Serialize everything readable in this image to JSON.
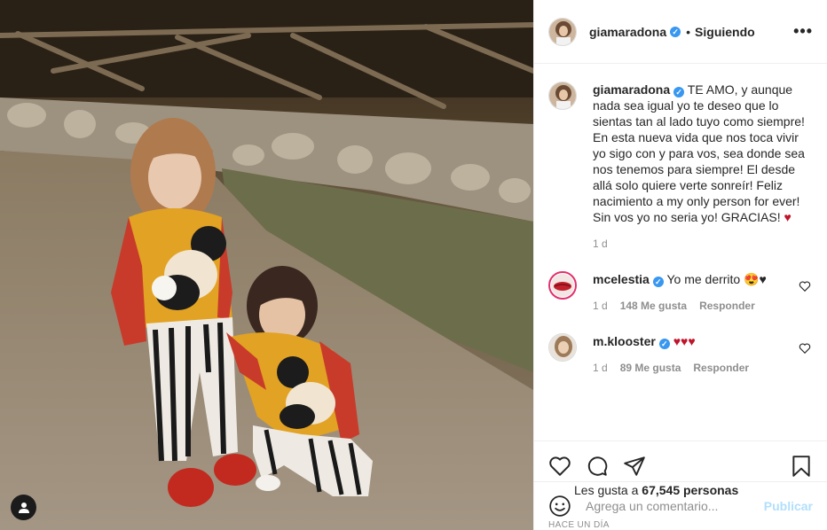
{
  "post": {
    "username": "giamaradona",
    "follow_state": "Siguiendo",
    "more_glyph": "•••",
    "caption_username": "giamaradona",
    "caption": "TE AMO, y aunque nada sea igual yo te deseo que lo sientas tan al lado tuyo como siempre! En esta nueva vida que nos toca vivir yo sigo con y para vos, sea donde sea nos tenemos para siempre! El desde allá solo quiere verte sonreír! Feliz nacimiento a my only person for ever! Sin vos yo no seria yo! GRACIAS! ",
    "caption_emoji": "♥",
    "caption_time": "1 d",
    "likes_prefix": "Les gusta a",
    "likes_count": "67,545",
    "likes_suffix": "personas",
    "age": "HACE UN DÍA"
  },
  "comments": [
    {
      "username": "mcelestia",
      "text": "Yo me derrito 😍♥",
      "time": "1 d",
      "likes": "148 Me gusta",
      "reply": "Responder"
    },
    {
      "username": "m.klooster",
      "text": "♥♥♥",
      "time": "1 d",
      "likes": "89 Me gusta",
      "reply": "Responder"
    }
  ],
  "composer": {
    "placeholder": "Agrega un comentario...",
    "publish_label": "Publicar"
  },
  "icons": {
    "verified": "verified-badge-icon",
    "like": "heart-outline-icon",
    "comment": "speech-bubble-icon",
    "share": "paper-plane-icon",
    "save": "bookmark-icon",
    "emoji": "smiley-icon",
    "user_tag": "person-icon"
  },
  "colors": {
    "verified": "#3897f0",
    "publish_disabled": "#b2dffc",
    "muted": "#8e8e8e",
    "text": "#262626"
  }
}
